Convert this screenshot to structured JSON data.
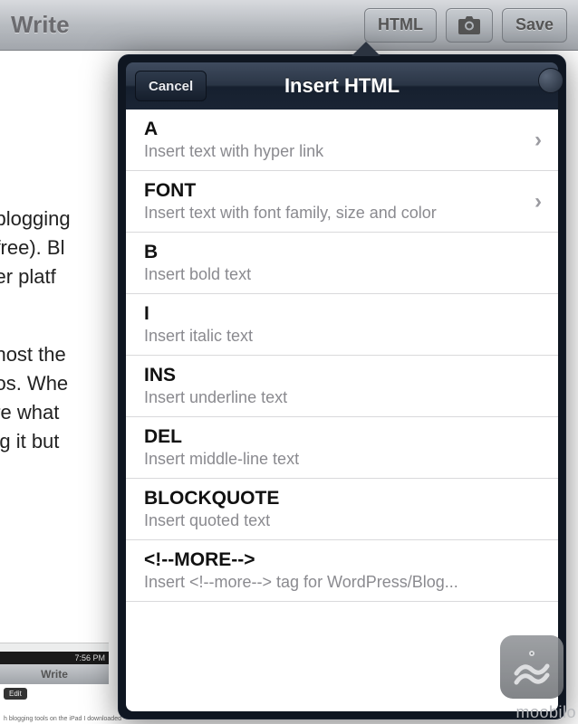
{
  "toolbar": {
    "title": "Write",
    "html_btn": "HTML",
    "save_btn": "Save",
    "camera_icon": "camera-icon"
  },
  "background_doc": {
    "para1": "th blogging\ns (free). Bl\ngger platf",
    "para2": "to host the\ndeos. Whe\nsure what\nning it but"
  },
  "thumbnail": {
    "time": "7:56 PM",
    "title": "Write",
    "edit": "Edit",
    "caption": "h blogging tools on the iPad I downloaded"
  },
  "popover": {
    "title": "Insert HTML",
    "cancel": "Cancel",
    "items": [
      {
        "title": "A",
        "subtitle": "Insert text with hyper link",
        "disclosure": true
      },
      {
        "title": "FONT",
        "subtitle": "Insert text with font family, size and color",
        "disclosure": true
      },
      {
        "title": "B",
        "subtitle": "Insert bold text",
        "disclosure": false
      },
      {
        "title": "I",
        "subtitle": "Insert italic text",
        "disclosure": false
      },
      {
        "title": "INS",
        "subtitle": "Insert underline text",
        "disclosure": false
      },
      {
        "title": "DEL",
        "subtitle": "Insert middle-line text",
        "disclosure": false
      },
      {
        "title": "BLOCKQUOTE",
        "subtitle": "Insert quoted text",
        "disclosure": false
      },
      {
        "title": "<!--MORE-->",
        "subtitle": "Insert <!--more--> tag for WordPress/Blog...",
        "disclosure": false
      }
    ]
  },
  "watermark": "moobilo"
}
